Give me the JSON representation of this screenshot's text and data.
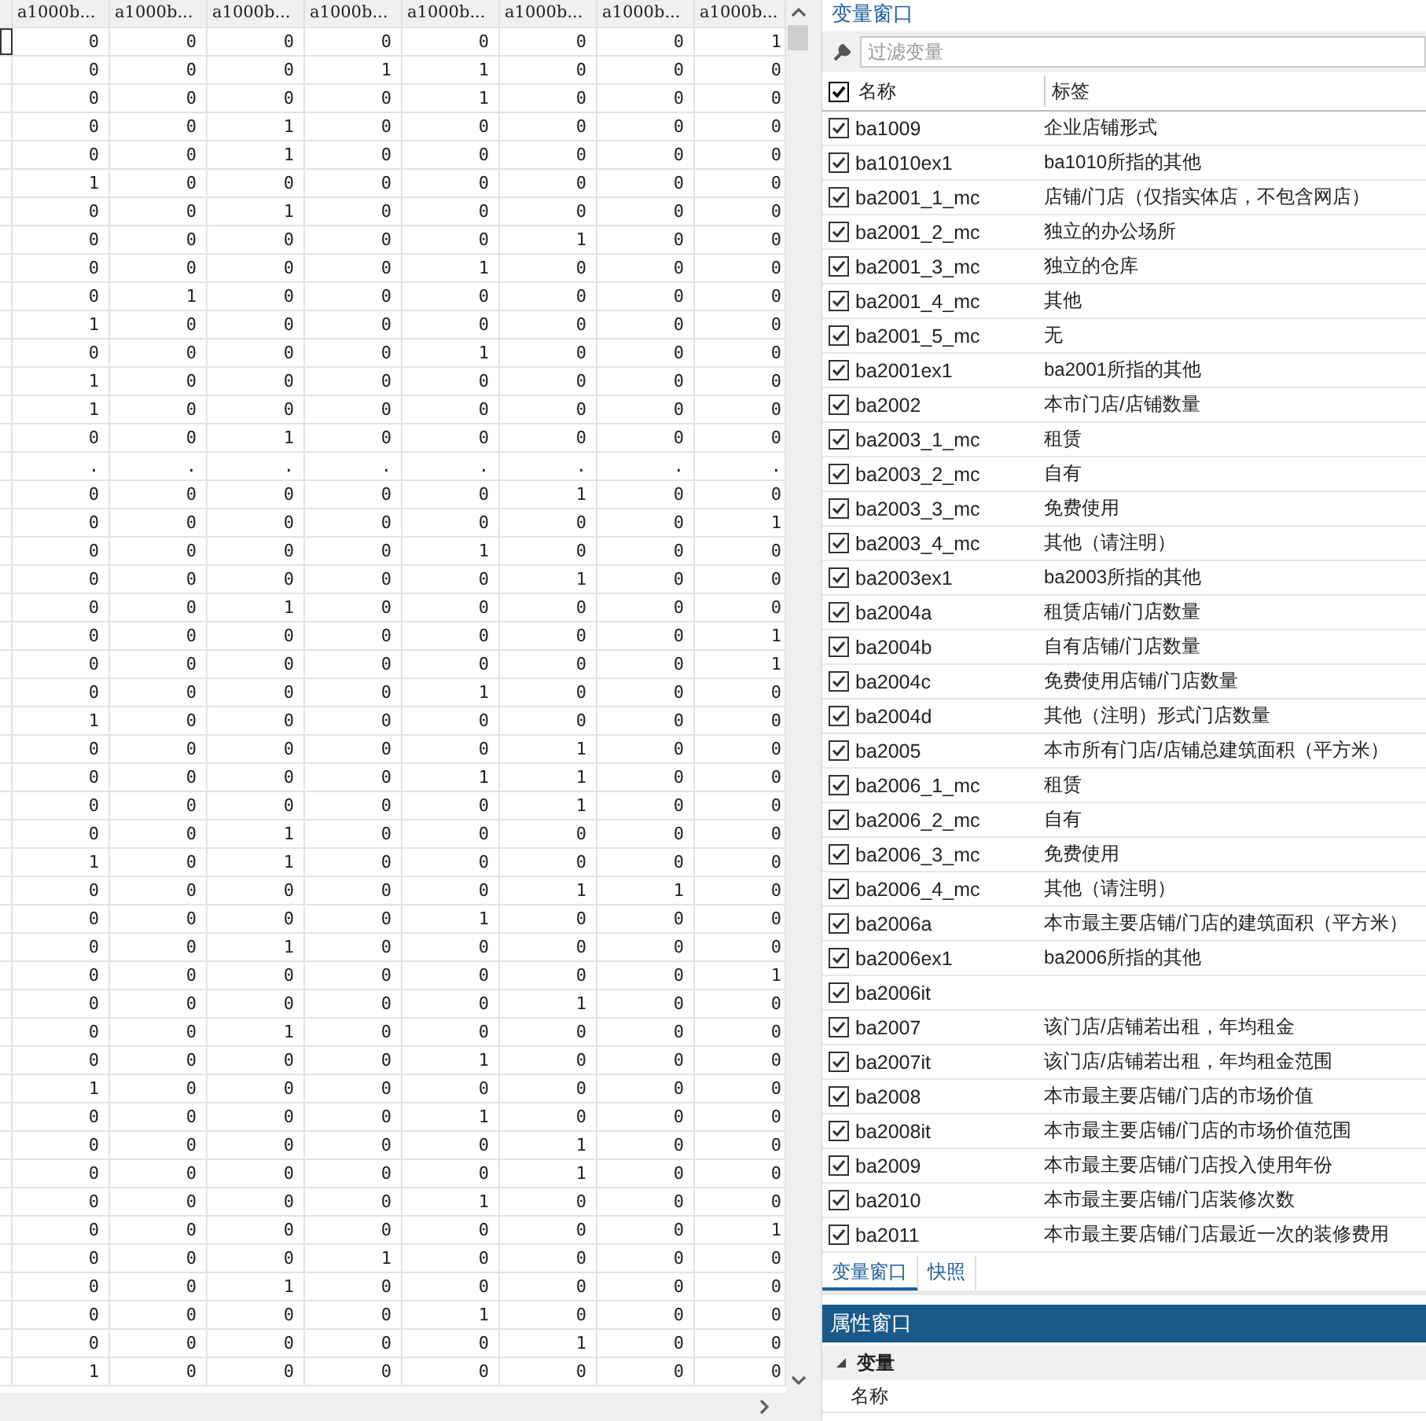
{
  "data_grid": {
    "columns": [
      "a1000b...",
      "a1000b...",
      "a1000b...",
      "a1000b...",
      "a1000b...",
      "a1000b...",
      "a1000b...",
      "a1000b..."
    ],
    "rows": [
      [
        "0",
        "0",
        "0",
        "0",
        "0",
        "0",
        "0",
        "1"
      ],
      [
        "0",
        "0",
        "0",
        "1",
        "1",
        "0",
        "0",
        "0"
      ],
      [
        "0",
        "0",
        "0",
        "0",
        "1",
        "0",
        "0",
        "0"
      ],
      [
        "0",
        "0",
        "1",
        "0",
        "0",
        "0",
        "0",
        "0"
      ],
      [
        "0",
        "0",
        "1",
        "0",
        "0",
        "0",
        "0",
        "0"
      ],
      [
        "1",
        "0",
        "0",
        "0",
        "0",
        "0",
        "0",
        "0"
      ],
      [
        "0",
        "0",
        "1",
        "0",
        "0",
        "0",
        "0",
        "0"
      ],
      [
        "0",
        "0",
        "0",
        "0",
        "0",
        "1",
        "0",
        "0"
      ],
      [
        "0",
        "0",
        "0",
        "0",
        "1",
        "0",
        "0",
        "0"
      ],
      [
        "0",
        "1",
        "0",
        "0",
        "0",
        "0",
        "0",
        "0"
      ],
      [
        "1",
        "0",
        "0",
        "0",
        "0",
        "0",
        "0",
        "0"
      ],
      [
        "0",
        "0",
        "0",
        "0",
        "1",
        "0",
        "0",
        "0"
      ],
      [
        "1",
        "0",
        "0",
        "0",
        "0",
        "0",
        "0",
        "0"
      ],
      [
        "1",
        "0",
        "0",
        "0",
        "0",
        "0",
        "0",
        "0"
      ],
      [
        "0",
        "0",
        "1",
        "0",
        "0",
        "0",
        "0",
        "0"
      ],
      [
        ".",
        ".",
        ".",
        ".",
        ".",
        ".",
        ".",
        "."
      ],
      [
        "0",
        "0",
        "0",
        "0",
        "0",
        "1",
        "0",
        "0"
      ],
      [
        "0",
        "0",
        "0",
        "0",
        "0",
        "0",
        "0",
        "1"
      ],
      [
        "0",
        "0",
        "0",
        "0",
        "1",
        "0",
        "0",
        "0"
      ],
      [
        "0",
        "0",
        "0",
        "0",
        "0",
        "1",
        "0",
        "0"
      ],
      [
        "0",
        "0",
        "1",
        "0",
        "0",
        "0",
        "0",
        "0"
      ],
      [
        "0",
        "0",
        "0",
        "0",
        "0",
        "0",
        "0",
        "1"
      ],
      [
        "0",
        "0",
        "0",
        "0",
        "0",
        "0",
        "0",
        "1"
      ],
      [
        "0",
        "0",
        "0",
        "0",
        "1",
        "0",
        "0",
        "0"
      ],
      [
        "1",
        "0",
        "0",
        "0",
        "0",
        "0",
        "0",
        "0"
      ],
      [
        "0",
        "0",
        "0",
        "0",
        "0",
        "1",
        "0",
        "0"
      ],
      [
        "0",
        "0",
        "0",
        "0",
        "1",
        "1",
        "0",
        "0"
      ],
      [
        "0",
        "0",
        "0",
        "0",
        "0",
        "1",
        "0",
        "0"
      ],
      [
        "0",
        "0",
        "1",
        "0",
        "0",
        "0",
        "0",
        "0"
      ],
      [
        "1",
        "0",
        "1",
        "0",
        "0",
        "0",
        "0",
        "0"
      ],
      [
        "0",
        "0",
        "0",
        "0",
        "0",
        "1",
        "1",
        "0"
      ],
      [
        "0",
        "0",
        "0",
        "0",
        "1",
        "0",
        "0",
        "0"
      ],
      [
        "0",
        "0",
        "1",
        "0",
        "0",
        "0",
        "0",
        "0"
      ],
      [
        "0",
        "0",
        "0",
        "0",
        "0",
        "0",
        "0",
        "1"
      ],
      [
        "0",
        "0",
        "0",
        "0",
        "0",
        "1",
        "0",
        "0"
      ],
      [
        "0",
        "0",
        "1",
        "0",
        "0",
        "0",
        "0",
        "0"
      ],
      [
        "0",
        "0",
        "0",
        "0",
        "1",
        "0",
        "0",
        "0"
      ],
      [
        "1",
        "0",
        "0",
        "0",
        "0",
        "0",
        "0",
        "0"
      ],
      [
        "0",
        "0",
        "0",
        "0",
        "1",
        "0",
        "0",
        "0"
      ],
      [
        "0",
        "0",
        "0",
        "0",
        "0",
        "1",
        "0",
        "0"
      ],
      [
        "0",
        "0",
        "0",
        "0",
        "0",
        "1",
        "0",
        "0"
      ],
      [
        "0",
        "0",
        "0",
        "0",
        "1",
        "0",
        "0",
        "0"
      ],
      [
        "0",
        "0",
        "0",
        "0",
        "0",
        "0",
        "0",
        "1"
      ],
      [
        "0",
        "0",
        "0",
        "1",
        "0",
        "0",
        "0",
        "0"
      ],
      [
        "0",
        "0",
        "1",
        "0",
        "0",
        "0",
        "0",
        "0"
      ],
      [
        "0",
        "0",
        "0",
        "0",
        "1",
        "0",
        "0",
        "0"
      ],
      [
        "0",
        "0",
        "0",
        "0",
        "0",
        "1",
        "0",
        "0"
      ],
      [
        "1",
        "0",
        "0",
        "0",
        "0",
        "0",
        "0",
        "0"
      ]
    ]
  },
  "variable_window": {
    "title": "变量窗口",
    "filter": {
      "placeholder": "过滤变量"
    },
    "header": {
      "all_checked": true,
      "name": "名称",
      "label": "标签"
    },
    "variables": [
      {
        "name": "ba1009",
        "label": "企业店铺形式",
        "checked": true
      },
      {
        "name": "ba1010ex1",
        "label": "ba1010所指的其他",
        "checked": true
      },
      {
        "name": "ba2001_1_mc",
        "label": "店铺/门店（仅指实体店，不包含网店）",
        "checked": true
      },
      {
        "name": "ba2001_2_mc",
        "label": "独立的办公场所",
        "checked": true
      },
      {
        "name": "ba2001_3_mc",
        "label": "独立的仓库",
        "checked": true
      },
      {
        "name": "ba2001_4_mc",
        "label": "其他",
        "checked": true
      },
      {
        "name": "ba2001_5_mc",
        "label": "无",
        "checked": true
      },
      {
        "name": "ba2001ex1",
        "label": "ba2001所指的其他",
        "checked": true
      },
      {
        "name": "ba2002",
        "label": "本市门店/店铺数量",
        "checked": true
      },
      {
        "name": "ba2003_1_mc",
        "label": "租赁",
        "checked": true
      },
      {
        "name": "ba2003_2_mc",
        "label": "自有",
        "checked": true
      },
      {
        "name": "ba2003_3_mc",
        "label": "免费使用",
        "checked": true
      },
      {
        "name": "ba2003_4_mc",
        "label": "其他（请注明）",
        "checked": true
      },
      {
        "name": "ba2003ex1",
        "label": "ba2003所指的其他",
        "checked": true
      },
      {
        "name": "ba2004a",
        "label": "租赁店铺/门店数量",
        "checked": true
      },
      {
        "name": "ba2004b",
        "label": "自有店铺/门店数量",
        "checked": true
      },
      {
        "name": "ba2004c",
        "label": "免费使用店铺/门店数量",
        "checked": true
      },
      {
        "name": "ba2004d",
        "label": "其他（注明）形式门店数量",
        "checked": true
      },
      {
        "name": "ba2005",
        "label": "本市所有门店/店铺总建筑面积（平方米）",
        "checked": true
      },
      {
        "name": "ba2006_1_mc",
        "label": "租赁",
        "checked": true
      },
      {
        "name": "ba2006_2_mc",
        "label": "自有",
        "checked": true
      },
      {
        "name": "ba2006_3_mc",
        "label": "免费使用",
        "checked": true
      },
      {
        "name": "ba2006_4_mc",
        "label": "其他（请注明）",
        "checked": true
      },
      {
        "name": "ba2006a",
        "label": "本市最主要店铺/门店的建筑面积（平方米）",
        "checked": true
      },
      {
        "name": "ba2006ex1",
        "label": "ba2006所指的其他",
        "checked": true
      },
      {
        "name": "ba2006it",
        "checked": true
      },
      {
        "name": "ba2007",
        "label": "该门店/店铺若出租，年均租金",
        "checked": true
      },
      {
        "name": "ba2007it",
        "label": "该门店/店铺若出租，年均租金范围",
        "checked": true
      },
      {
        "name": "ba2008",
        "label": "本市最主要店铺/门店的市场价值",
        "checked": true
      },
      {
        "name": "ba2008it",
        "label": "本市最主要店铺/门店的市场价值范围",
        "checked": true
      },
      {
        "name": "ba2009",
        "label": "本市最主要店铺/门店投入使用年份",
        "checked": true
      },
      {
        "name": "ba2010",
        "label": "本市最主要店铺/门店装修次数",
        "checked": true
      },
      {
        "name": "ba2011",
        "label": "本市最主要店铺/门店最近一次的装修费用",
        "checked": true
      }
    ]
  },
  "tabs": [
    {
      "label": "变量窗口",
      "selected": true
    },
    {
      "label": "快照",
      "selected": false
    }
  ],
  "properties": {
    "title": "属性窗口",
    "groups": [
      {
        "name": "变量",
        "expanded": true,
        "items": [
          "名称"
        ]
      }
    ]
  }
}
